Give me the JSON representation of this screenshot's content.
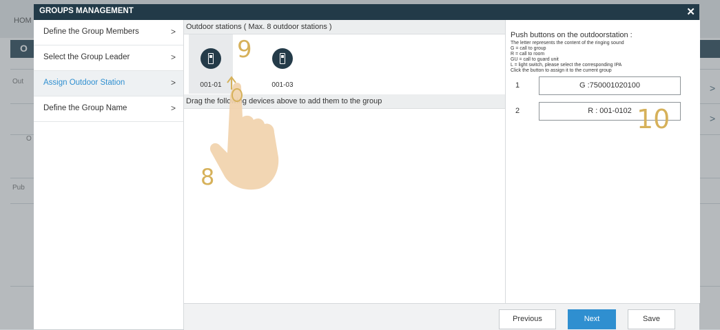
{
  "background": {
    "home_label": "HOM",
    "band_letter": "O",
    "truncated_labels": [
      "Out",
      "O",
      "Pub"
    ]
  },
  "dialog": {
    "title": "GROUPS MANAGEMENT",
    "close_symbol": "✕"
  },
  "nav": {
    "chevron": ">",
    "items": [
      {
        "label": "Define the Group Members"
      },
      {
        "label": "Select the Group Leader"
      },
      {
        "label": "Assign Outdoor Station"
      },
      {
        "label": "Define the Group Name"
      }
    ],
    "active_index": 2
  },
  "outdoor": {
    "header": "Outdoor stations ( Max. 8 outdoor stations )",
    "stations": [
      {
        "label": "001-01",
        "icon": "outdoor-station-icon",
        "selected": true
      },
      {
        "label": "001-03",
        "icon": "outdoor-station-icon",
        "selected": false
      }
    ]
  },
  "drag": {
    "header": "Drag the following devices above to add them to the group"
  },
  "right_panel": {
    "title": "Push buttons on the outdoorstation :",
    "lines": [
      "The letter represents the content of the ringing sound",
      "G = call to group",
      "R = call to room",
      "GU = call to guard unit",
      "L = light switch, please select the corresponding IPA",
      "Click the button to assign it to the current group"
    ],
    "buttons": [
      {
        "number": "1",
        "value": "G :750001020100"
      },
      {
        "number": "2",
        "value": "R : 001-0102"
      }
    ]
  },
  "footer": {
    "previous": "Previous",
    "next": "Next",
    "save": "Save"
  },
  "annotations": {
    "step8": "8",
    "step9": "9",
    "step10": "10",
    "hand_icon": "pointing-hand-icon"
  },
  "colors": {
    "title_bar": "#223a48",
    "accent": "#2f8fd0",
    "annotation": "#d6b15a"
  }
}
